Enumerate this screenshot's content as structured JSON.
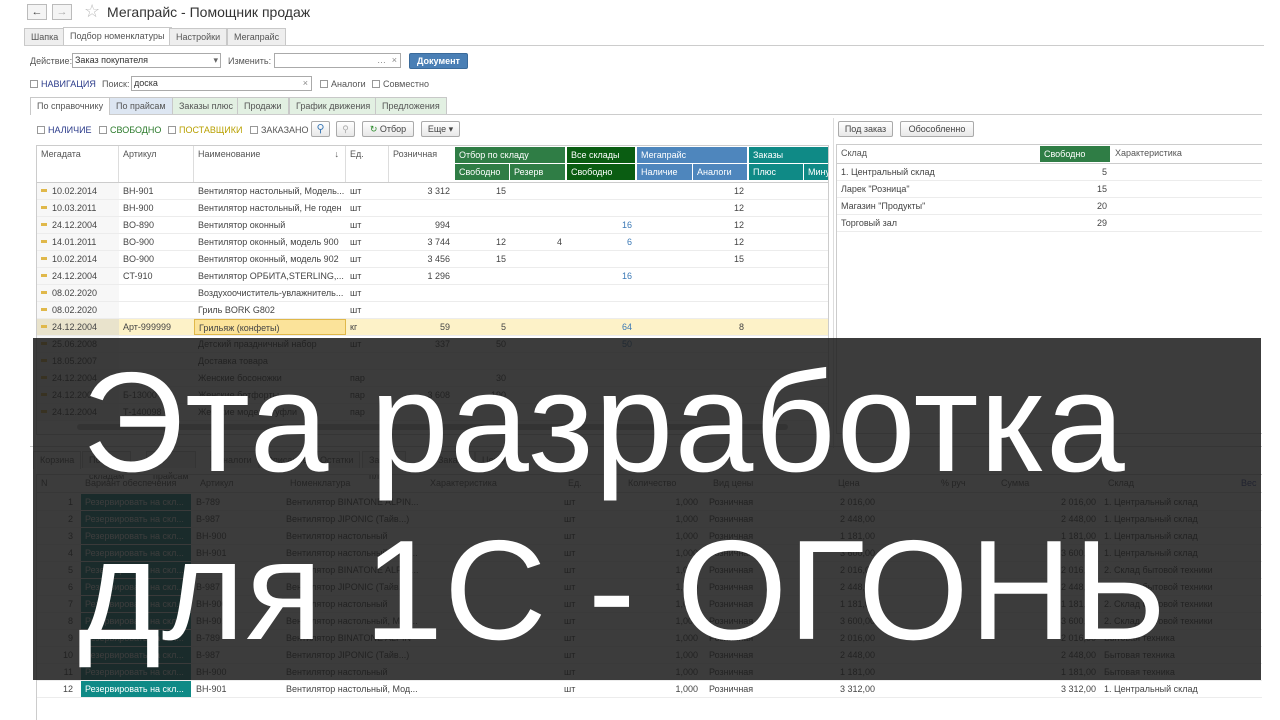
{
  "window": {
    "title": "Мегапрайс - Помощник продаж",
    "back_icon": "←",
    "forward_icon": "→",
    "star_icon": "☆"
  },
  "main_tabs": [
    "Шапка",
    "Подбор номенклатуры",
    "Настройки",
    "Мегапрайс"
  ],
  "action": {
    "label": "Действие:",
    "value": "Заказ покупателя",
    "change_label": "Изменить:",
    "change_value": "",
    "document_button": "Документ"
  },
  "search": {
    "navigation_label": "НАВИГАЦИЯ",
    "label": "Поиск:",
    "value": "доска",
    "analogs_label": "Аналоги",
    "joint_label": "Совместно"
  },
  "sub_tabs": [
    "По справочнику",
    "По прайсам",
    "Заказы плюс",
    "Продажи",
    "График движения",
    "Предложения"
  ],
  "filters": {
    "availability": "НАЛИЧИЕ",
    "free": "СВОБОДНО",
    "suppliers": "ПОСТАВЩИКИ",
    "ordered": "ЗАКАЗАНО",
    "select_button": "Отбор",
    "more_button": "Еще ▾"
  },
  "colors": {
    "green": "#2f7d45",
    "dark_green": "#0a5d12",
    "blue": "#4e86bd",
    "teal": "#0f8a86",
    "selected_row": "#fdf2c8"
  },
  "product_table": {
    "headers": {
      "megadate": "Мегадата",
      "article": "Артикул",
      "name": "Наименование",
      "sort_icon": "↓",
      "unit": "Ед.",
      "retail": "Розничная",
      "stock_group": "Отбор по складу",
      "stock_free": "Свободно",
      "stock_reserve": "Резерв",
      "all_group": "Все склады",
      "all_free": "Свободно",
      "megaprice_group": "Мегапрайс",
      "mp_avail": "Наличие",
      "mp_analogs": "Аналоги",
      "orders_group": "Заказы",
      "orders_plus": "Плюс",
      "orders_minus": "Минус"
    },
    "rows": [
      [
        "10.02.2014",
        "BH-901",
        "Вентилятор настольный, Модель...",
        "шт",
        "3 312",
        "15",
        "",
        "",
        "",
        "12"
      ],
      [
        "10.03.2011",
        "BH-900",
        "Вентилятор настольный, Не годен",
        "шт",
        "",
        "",
        "",
        "",
        "",
        "12"
      ],
      [
        "24.12.2004",
        "BO-890",
        "Вентилятор оконный",
        "шт",
        "994",
        "",
        "",
        "16",
        "",
        "12"
      ],
      [
        "14.01.2011",
        "BO-900",
        "Вентилятор оконный, модель 900",
        "шт",
        "3 744",
        "12",
        "4",
        "6",
        "",
        "12"
      ],
      [
        "10.02.2014",
        "BO-900",
        "Вентилятор оконный, модель 902",
        "шт",
        "3 456",
        "15",
        "",
        "",
        "",
        "15"
      ],
      [
        "24.12.2004",
        "CT-910",
        "Вентилятор ОРБИТА,STERLING,...",
        "шт",
        "1 296",
        "",
        "",
        "16",
        "",
        ""
      ],
      [
        "08.02.2020",
        "",
        "Воздухоочиститель-увлажнитель...",
        "шт",
        "",
        "",
        "",
        "",
        "",
        ""
      ],
      [
        "08.02.2020",
        "",
        "Гриль BORK G802",
        "шт",
        "",
        "",
        "",
        "",
        "",
        ""
      ],
      [
        "24.12.2004",
        "Арт-999999",
        "Грильяж (конфеты)",
        "кг",
        "59",
        "5",
        "",
        "64",
        "",
        "8"
      ],
      [
        "25.06.2008",
        "",
        "Детский праздничный набор",
        "шт",
        "337",
        "50",
        "",
        "50",
        "",
        ""
      ],
      [
        "18.05.2007",
        "",
        "Доставка товара",
        "",
        "",
        "",
        "",
        "",
        "",
        ""
      ],
      [
        "24.12.2004",
        "",
        "Женские босоножки",
        "пар",
        "",
        "30",
        "",
        "",
        "",
        ""
      ],
      [
        "24.12.2004",
        "Б-13000",
        "Женские ботфорты",
        "пар",
        "3 608",
        "190",
        "",
        "",
        "",
        ""
      ],
      [
        "24.12.2004",
        "Т-140098",
        "Женские модели туфли",
        "пар",
        "",
        "",
        "",
        "",
        "",
        ""
      ]
    ]
  },
  "stock_panel": {
    "under_order_button": "Под заказ",
    "separate_button": "Обособленно",
    "headers": [
      "Склад",
      "Свободно",
      "Характеристика"
    ],
    "rows": [
      [
        "1. Центральный склад",
        "5"
      ],
      [
        "Ларек \"Розница\"",
        "15"
      ],
      [
        "Магазин \"Продукты\"",
        "20"
      ],
      [
        "Торговый зал",
        "29"
      ]
    ]
  },
  "cart_tabs": [
    "Корзина",
    "По складам",
    "По прайсам",
    "Аналоги",
    "Описание",
    "Остатки",
    "Заказы плюс",
    "Заказы",
    "Цены"
  ],
  "cart_table": {
    "headers": [
      "N",
      "Вариант обеспечения",
      "Артикул",
      "Номенклатура",
      "Характеристика",
      "Ед.",
      "Количество",
      "Вид цены",
      "Цена",
      "% руч",
      "Сумма",
      "Склад",
      "Вес"
    ],
    "rows": [
      [
        "1",
        "Резервировать на скл...",
        "B-789",
        "Вентилятор BINATONE ALPIN...",
        "шт",
        "1,000",
        "Розничная",
        "2 016,00",
        "2 016,00",
        "1. Центральный склад"
      ],
      [
        "2",
        "Резервировать на скл...",
        "B-987",
        "Вентилятор JIPONIC (Тайв...)",
        "шт",
        "1,000",
        "Розничная",
        "2 448,00",
        "2 448,00",
        "1. Центральный склад"
      ],
      [
        "3",
        "Резервировать на скл...",
        "BH-900",
        "Вентилятор настольный",
        "шт",
        "1,000",
        "Розничная",
        "1 181,00",
        "1 181,00",
        "1. Центральный склад"
      ],
      [
        "4",
        "Резервировать на скл...",
        "BH-901",
        "Вентилятор настольный, Мод...",
        "шт",
        "1,000",
        "Розничная",
        "3 600,00",
        "3 600,00",
        "1. Центральный склад"
      ],
      [
        "5",
        "Резервировать на скл...",
        "B-789",
        "Вентилятор BINATONE ALPIN...",
        "шт",
        "1,000",
        "Розничная",
        "2 016,00",
        "2 016,00",
        "2. Склад бытовой техники"
      ],
      [
        "6",
        "Резервировать на скл...",
        "B-987",
        "Вентилятор JIPONIC (Тайв...)",
        "шт",
        "1,000",
        "Розничная",
        "2 448,00",
        "2 448,00",
        "2. Склад бытовой техники"
      ],
      [
        "7",
        "Резервировать на скл...",
        "BH-900",
        "Вентилятор настольный",
        "шт",
        "1,000",
        "Розничная",
        "1 181,00",
        "1 181,00",
        "2. Склад бытовой техники"
      ],
      [
        "8",
        "Резервировать на скл...",
        "BH-901",
        "Вентилятор настольный, Мод...",
        "шт",
        "1,000",
        "Розничная",
        "3 600,00",
        "3 600,00",
        "2. Склад бытовой техники"
      ],
      [
        "9",
        "Резервировать на скл...",
        "B-789",
        "Вентилятор BINATONE ALPIN",
        "шт",
        "1,000",
        "Розничная",
        "2 016,00",
        "2 016,00",
        "Бытовая техника"
      ],
      [
        "10",
        "Резервировать на скл...",
        "B-987",
        "Вентилятор JIPONIC (Тайв...)",
        "шт",
        "1,000",
        "Розничная",
        "2 448,00",
        "2 448,00",
        "Бытовая техника"
      ],
      [
        "11",
        "Резервировать на скл...",
        "BH-900",
        "Вентилятор настольный",
        "шт",
        "1,000",
        "Розничная",
        "1 181,00",
        "1 181,00",
        "Бытовая техника"
      ],
      [
        "12",
        "Резервировать на скл...",
        "BH-901",
        "Вентилятор настольный, Мод...",
        "шт",
        "1,000",
        "Розничная",
        "3 312,00",
        "3 312,00",
        "1. Центральный склад"
      ]
    ]
  },
  "overlay": {
    "line1": "Эта разработка",
    "line2": "для 1С - ОГОНЬ"
  }
}
